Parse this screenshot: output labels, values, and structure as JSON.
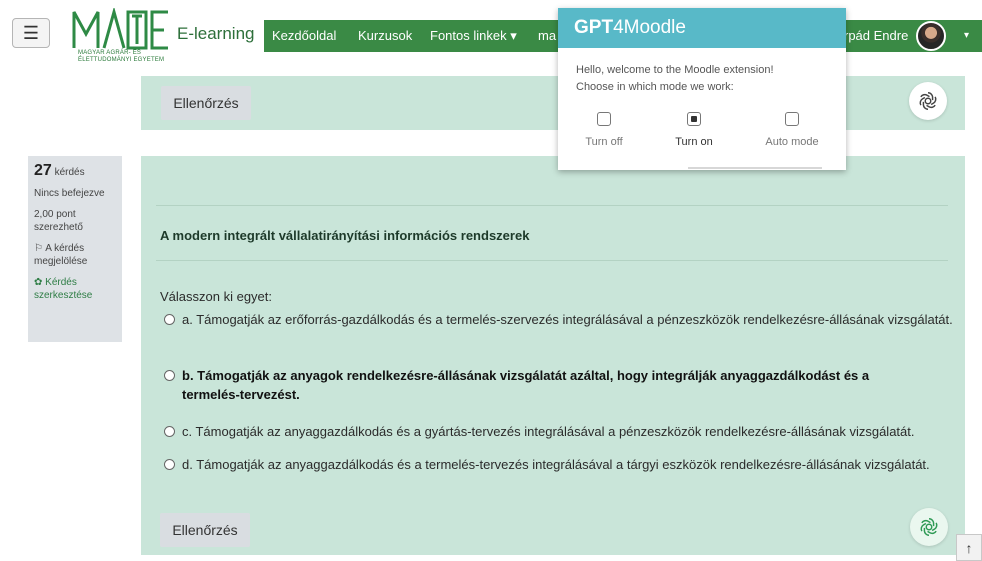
{
  "header": {
    "menu_icon": "hamburger-icon",
    "logo_text": "MATE",
    "logo_subtitle_1": "MAGYAR AGRÁR- ÉS",
    "logo_subtitle_2": "ÉLETTUDOMÁNYI EGYETEM",
    "site_label": "E-learning",
    "nav": [
      {
        "label": "Kezdőoldal"
      },
      {
        "label": "Kurzusok"
      },
      {
        "label": "Fontos linkek ▾"
      },
      {
        "label": "ma"
      }
    ],
    "user_name": "rpád Endre",
    "caret": "▾"
  },
  "top_panel": {
    "check_button": "Ellenőrzés",
    "badge_icon": "chatgpt-icon"
  },
  "question_info": {
    "number": "27",
    "number_suffix": " kérdés",
    "status": "Nincs befejezve",
    "points_line1": "2,00 pont",
    "points_line2": "szerezhető",
    "flag_line1": "A kérdés",
    "flag_line2": "megjelölése",
    "edit_line1": "Kérdés",
    "edit_line2": "szerkesztése"
  },
  "question": {
    "title": "A modern integrált vállalatirányítási információs rendszerek",
    "prompt": "Válasszon ki egyet:",
    "answers": [
      {
        "text": "a. Támogatják az erőforrás-gazdálkodás és a termelés-szervezés integrálásával a pénzeszközök rendelkezésre-állásának vizsgálatát."
      },
      {
        "text": "b. Támogatják az anyagok rendelkezésre-állásának vizsgálatát azáltal, hogy integrálják anyaggazdálkodást és a termelés-tervezést."
      },
      {
        "text": "c. Támogatják az anyaggazdálkodás és a gyártás-tervezés integrálásával a pénzeszközök rendelkezésre-állásának vizsgálatát."
      },
      {
        "text": "d. Támogatják az anyaggazdálkodás és a termelés-tervezés integrálásával a tárgyi eszközök rendelkezésre-állásának vizsgálatát."
      }
    ],
    "check_button": "Ellenőrzés"
  },
  "popup": {
    "title_bold": "GPT",
    "title_rest": "4Moodle",
    "line1": "Hello, welcome to the Moodle extension!",
    "line2": "Choose in which mode we work:",
    "modes": [
      {
        "label": "Turn off",
        "checked": false
      },
      {
        "label": "Turn on",
        "checked": true
      },
      {
        "label": "Auto mode",
        "checked": false
      }
    ]
  },
  "scroll_top": "🡑"
}
